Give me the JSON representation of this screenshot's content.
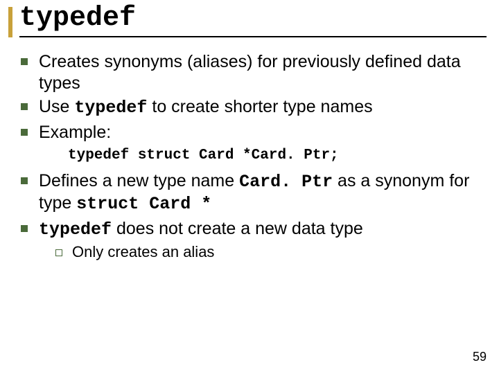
{
  "title": "typedef",
  "bullets": {
    "b1": "Creates synonyms (aliases) for previously defined data types",
    "b2_pre": "Use ",
    "b2_code": "typedef",
    "b2_post": " to create shorter type names",
    "b3": "Example:",
    "code": "typedef struct Card *Card. Ptr;",
    "b4_pre": "Defines a new type name ",
    "b4_code1": "Card. Ptr",
    "b4_mid": " as a synonym for type ",
    "b4_code2": "struct Card *",
    "b5_code": "typedef",
    "b5_post": " does not create a new data type",
    "sub1": "Only creates an alias"
  },
  "page": "59"
}
